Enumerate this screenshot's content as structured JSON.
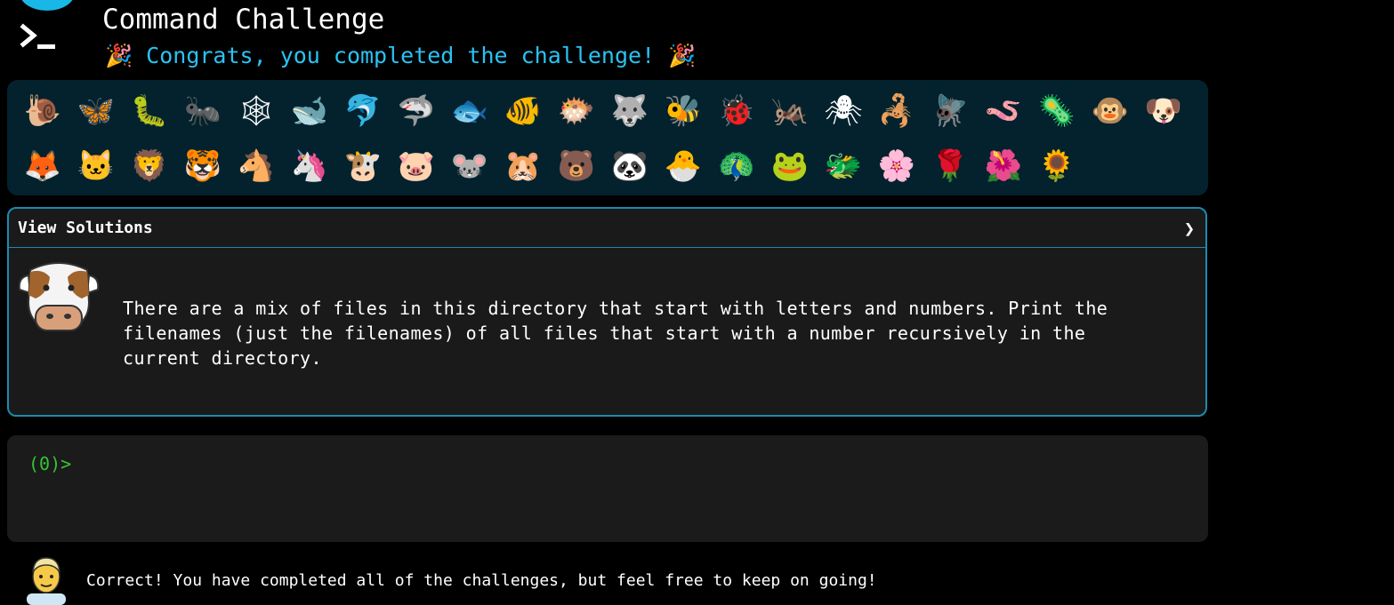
{
  "header": {
    "title": "Command Challenge",
    "congrats": "🎉 Congrats, you completed the challenge! 🎉",
    "logo_icon": "terminal-prompt-icon",
    "accent_color": "#29c3f3"
  },
  "badges": [
    {
      "icon": "snail-icon",
      "glyph": "🐌"
    },
    {
      "icon": "butterfly-icon",
      "glyph": "🦋"
    },
    {
      "icon": "caterpillar-icon",
      "glyph": "🐛"
    },
    {
      "icon": "ant-icon",
      "glyph": "🐜"
    },
    {
      "icon": "spider-web-icon",
      "glyph": "🕸"
    },
    {
      "icon": "whale-icon",
      "glyph": "🐋"
    },
    {
      "icon": "dolphin-icon",
      "glyph": "🐬"
    },
    {
      "icon": "shark-icon",
      "glyph": "🦈"
    },
    {
      "icon": "fish-icon",
      "glyph": "🐟"
    },
    {
      "icon": "tropical-fish-icon",
      "glyph": "🐠"
    },
    {
      "icon": "blowfish-icon",
      "glyph": "🐡"
    },
    {
      "icon": "wolf-icon",
      "glyph": "🐺"
    },
    {
      "icon": "bee-icon",
      "glyph": "🐝"
    },
    {
      "icon": "ladybug-icon",
      "glyph": "🐞"
    },
    {
      "icon": "cricket-icon",
      "glyph": "🦗"
    },
    {
      "icon": "spider-icon",
      "glyph": "🕷"
    },
    {
      "icon": "scorpion-icon",
      "glyph": "🦂"
    },
    {
      "icon": "fly-icon",
      "glyph": "🪰"
    },
    {
      "icon": "worm-icon",
      "glyph": "🪱"
    },
    {
      "icon": "microbe-icon",
      "glyph": "🦠"
    },
    {
      "icon": "monkey-face-icon",
      "glyph": "🐵"
    },
    {
      "icon": "dog-face-icon",
      "glyph": "🐶"
    },
    {
      "icon": "fox-icon",
      "glyph": "🦊"
    },
    {
      "icon": "cat-face-icon",
      "glyph": "🐱"
    },
    {
      "icon": "lion-icon",
      "glyph": "🦁"
    },
    {
      "icon": "tiger-face-icon",
      "glyph": "🐯"
    },
    {
      "icon": "horse-face-icon",
      "glyph": "🐴"
    },
    {
      "icon": "unicorn-icon",
      "glyph": "🦄"
    },
    {
      "icon": "cow-face-icon",
      "glyph": "🐮"
    },
    {
      "icon": "pig-face-icon",
      "glyph": "🐷"
    },
    {
      "icon": "mouse-face-icon",
      "glyph": "🐭"
    },
    {
      "icon": "hamster-icon",
      "glyph": "🐹"
    },
    {
      "icon": "bear-icon",
      "glyph": "🐻"
    },
    {
      "icon": "panda-icon",
      "glyph": "🐼"
    },
    {
      "icon": "hatching-chick-icon",
      "glyph": "🐣"
    },
    {
      "icon": "peacock-icon",
      "glyph": "🦚"
    },
    {
      "icon": "frog-icon",
      "glyph": "🐸"
    },
    {
      "icon": "dragon-face-icon",
      "glyph": "🐲"
    },
    {
      "icon": "cherry-blossom-icon",
      "glyph": "🌸"
    },
    {
      "icon": "rose-icon",
      "glyph": "🌹"
    },
    {
      "icon": "hibiscus-icon",
      "glyph": "🌺"
    },
    {
      "icon": "sunflower-icon",
      "glyph": "🌻"
    }
  ],
  "solutions": {
    "toggle_label": "View Solutions",
    "chevron": "❯",
    "avatar_icon": "cow-face-icon",
    "description": "There are a mix of files in this directory that start with letters and numbers. Print the filenames (just the filenames) of all files that start with a number recursively in the current directory.",
    "border_color": "#1d8aae"
  },
  "terminal": {
    "prompt": "(0)>",
    "prompt_color": "#35c435"
  },
  "status": {
    "avatar_icon": "man-avatar-icon",
    "message": "Correct! You have completed all of the challenges, but feel free to keep on going!"
  }
}
